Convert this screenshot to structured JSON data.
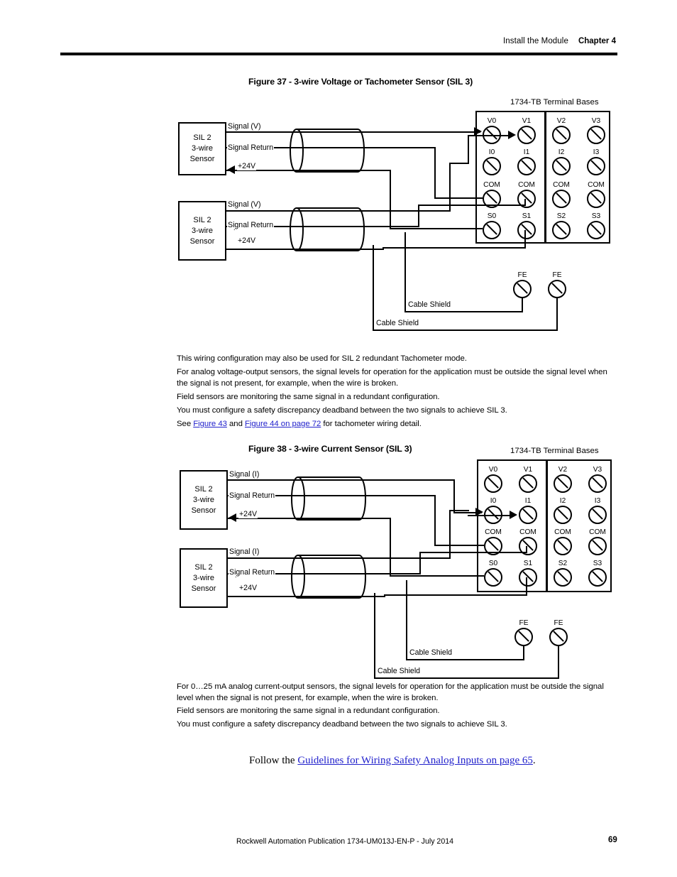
{
  "header": {
    "section": "Install the Module",
    "chapter": "Chapter 4"
  },
  "figures": [
    {
      "caption": "Figure 37 - 3-wire Voltage or Tachometer Sensor (SIL 3)",
      "terminal_base_title": "1734-TB Terminal Bases",
      "sensors": [
        {
          "line1": "SIL 2",
          "line2": "3-wire",
          "line3": "Sensor"
        },
        {
          "line1": "SIL 2",
          "line2": "3-wire",
          "line3": "Sensor"
        }
      ],
      "wire_labels": {
        "signal": "Signal (V)",
        "signal_return": "Signal Return",
        "supply": "+24V"
      },
      "shield_labels": [
        "Cable Shield",
        "Cable Shield"
      ],
      "fe_labels": [
        "FE",
        "FE"
      ],
      "terminals": {
        "row_v": [
          "V0",
          "V1",
          "V2",
          "V3"
        ],
        "row_i": [
          "I0",
          "I1",
          "I2",
          "I3"
        ],
        "row_com": [
          "COM",
          "COM",
          "COM",
          "COM"
        ],
        "row_s": [
          "S0",
          "S1",
          "S2",
          "S3"
        ]
      },
      "notes": [
        "This wiring configuration may also be used for SIL 2 redundant Tachometer mode.",
        "For analog voltage-output sensors, the signal levels for operation for the application must be outside the signal level when the signal is not present, for example, when the wire is broken.",
        "Field sensors are monitoring the same signal in a redundant configuration.",
        "You must configure a safety discrepancy deadband between the two signals to achieve SIL 3."
      ],
      "see_note": {
        "prefix": "See ",
        "link1": "Figure 43",
        "middle": " and ",
        "link2": "Figure 44 on page 72",
        "suffix": " for tachometer wiring detail."
      }
    },
    {
      "caption": "Figure 38 - 3-wire Current Sensor (SIL 3)",
      "terminal_base_title": "1734-TB Terminal Bases",
      "sensors": [
        {
          "line1": "SIL 2",
          "line2": "3-wire",
          "line3": "Sensor"
        },
        {
          "line1": "SIL 2",
          "line2": "3-wire",
          "line3": "Sensor"
        }
      ],
      "wire_labels": {
        "signal": "Signal (I)",
        "signal_return": "Signal Return",
        "supply": "+24V"
      },
      "shield_labels": [
        "Cable Shield",
        "Cable Shield"
      ],
      "fe_labels": [
        "FE",
        "FE"
      ],
      "terminals": {
        "row_v": [
          "V0",
          "V1",
          "V2",
          "V3"
        ],
        "row_i": [
          "I0",
          "I1",
          "I2",
          "I3"
        ],
        "row_com": [
          "COM",
          "COM",
          "COM",
          "COM"
        ],
        "row_s": [
          "S0",
          "S1",
          "S2",
          "S3"
        ]
      },
      "notes": [
        "For 0…25 mA analog current-output sensors, the signal levels for operation for the application must be outside the signal level when the signal is not present, for example, when the wire is broken.",
        "Field sensors are monitoring the same signal in a redundant configuration.",
        "You must configure a safety discrepancy deadband between the two signals to achieve SIL 3."
      ]
    }
  ],
  "follow": {
    "prefix": "Follow the ",
    "link": "Guidelines for Wiring Safety Analog Inputs on page 65",
    "suffix": "."
  },
  "footer": {
    "publication": "Rockwell Automation Publication 1734-UM013J-EN-P - July 2014",
    "page": "69"
  }
}
